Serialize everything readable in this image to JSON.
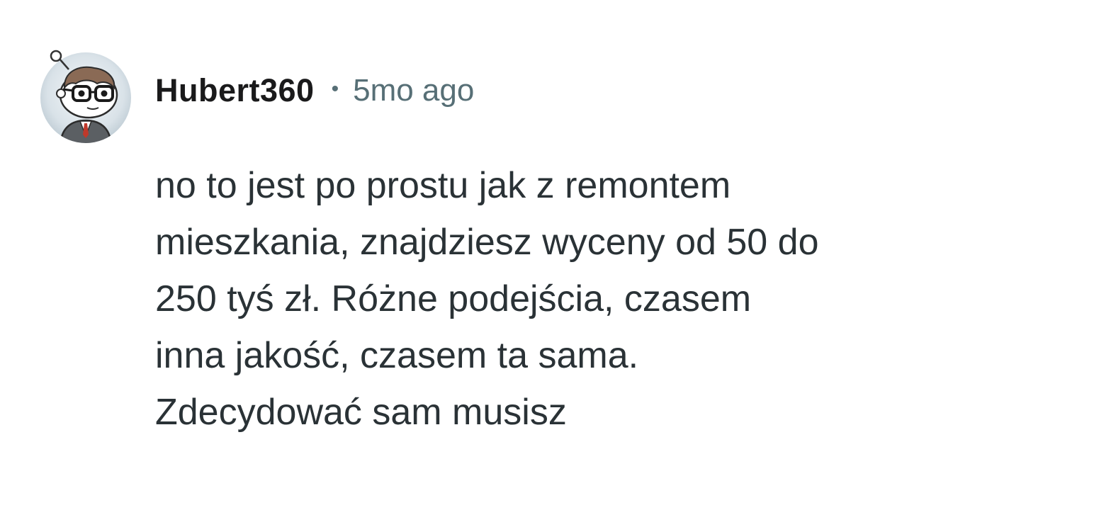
{
  "comment": {
    "author": "Hubert360",
    "separator": "•",
    "timestamp": "5mo ago",
    "avatar_icon": "snoo-avatar-icon",
    "body": "no to jest po prostu jak z remontem\nmieszkania, znajdziesz wyceny od 50 do\n250 tyś zł. Różne podejścia, czasem\ninna jakość, czasem ta sama.\nZdecydować sam musisz"
  },
  "colors": {
    "username": "#1a1a1b",
    "meta": "#576f76",
    "body": "#2a3236",
    "background": "#ffffff"
  }
}
